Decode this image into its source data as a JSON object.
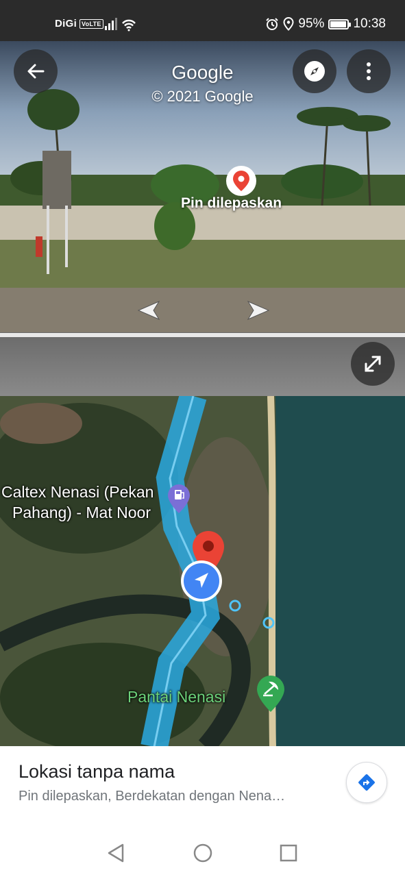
{
  "status_bar": {
    "carrier": "DiGi",
    "volte": "VoLTE",
    "battery_percent": "95%",
    "battery_level": 0.95,
    "time": "10:38"
  },
  "street_view": {
    "title": "Google",
    "copyright": "© 2021 Google",
    "pin_label": "Pin dilepaskan",
    "icons": [
      "back-arrow-icon",
      "compass-icon",
      "more-vert-icon",
      "location-pin-icon",
      "chevron-left-icon",
      "chevron-right-icon",
      "expand-icon"
    ]
  },
  "map": {
    "labels": [
      "Caltex Nenasi (Pekan",
      "Pahang) - Mat Noor",
      "Pantai Nenasi"
    ],
    "icons": [
      "gas-station-icon",
      "dropped-pin-icon",
      "street-view-pegman-icon",
      "beach-icon"
    ],
    "colors": {
      "route": "#2aa9e0",
      "pin": "#ea4335",
      "poi_green": "#34a853",
      "poi_purple": "#7b6fd6"
    }
  },
  "place": {
    "title": "Lokasi tanpa nama",
    "subtitle": "Pin dilepaskan, Berdekatan dengan Nena…",
    "directions_icon": "directions-icon"
  },
  "nav_bar": {
    "icons": [
      "nav-back-icon",
      "nav-home-icon",
      "nav-recents-icon"
    ]
  }
}
